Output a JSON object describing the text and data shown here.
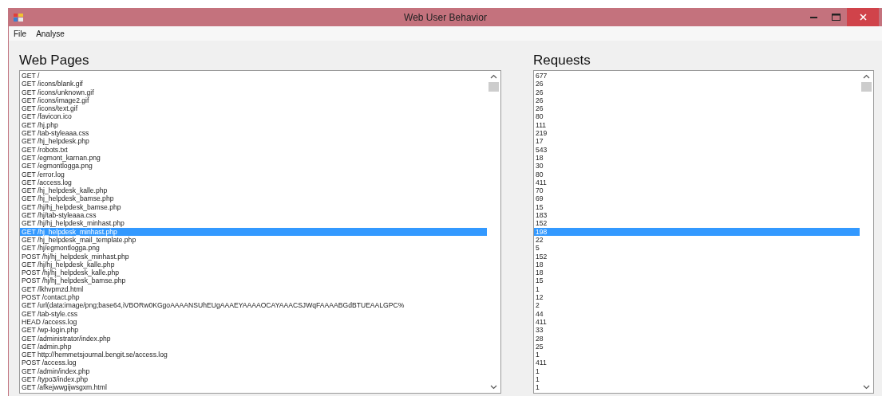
{
  "window": {
    "title": "Web User Behavior"
  },
  "menu": [
    "File",
    "Analyse"
  ],
  "pages": {
    "heading": "Web Pages",
    "items": [
      {
        "text": "GET /",
        "selected": false
      },
      {
        "text": "GET /icons/blank.gif",
        "selected": false
      },
      {
        "text": "GET /icons/unknown.gif",
        "selected": false
      },
      {
        "text": "GET /icons/image2.gif",
        "selected": false
      },
      {
        "text": "GET /icons/text.gif",
        "selected": false
      },
      {
        "text": "GET /favicon.ico",
        "selected": false
      },
      {
        "text": "GET /hj.php",
        "selected": false
      },
      {
        "text": "GET /tab-styleaaa.css",
        "selected": false
      },
      {
        "text": "GET /hj_helpdesk.php",
        "selected": false
      },
      {
        "text": "GET /robots.txt",
        "selected": false
      },
      {
        "text": "GET /egmont_karnan.png",
        "selected": false
      },
      {
        "text": "GET /egmontlogga.png",
        "selected": false
      },
      {
        "text": "GET /error.log",
        "selected": false
      },
      {
        "text": "GET /access.log",
        "selected": false
      },
      {
        "text": "GET /hj_helpdesk_kalle.php",
        "selected": false
      },
      {
        "text": "GET /hj_helpdesk_bamse.php",
        "selected": false
      },
      {
        "text": "GET /hj/hj_helpdesk_bamse.php",
        "selected": false
      },
      {
        "text": "GET /hj/tab-styleaaa.css",
        "selected": false
      },
      {
        "text": "GET /hj/hj_helpdesk_minhast.php",
        "selected": false
      },
      {
        "text": "GET /hj_helpdesk_minhast.php",
        "selected": true
      },
      {
        "text": "GET /hj_helpdesk_mail_template.php",
        "selected": false
      },
      {
        "text": "GET /hj/egmontlogga.png",
        "selected": false
      },
      {
        "text": "POST /hj/hj_helpdesk_minhast.php",
        "selected": false
      },
      {
        "text": "GET /hj/hj_helpdesk_kalle.php",
        "selected": false
      },
      {
        "text": "POST /hj/hj_helpdesk_kalle.php",
        "selected": false
      },
      {
        "text": "POST /hj/hj_helpdesk_bamse.php",
        "selected": false
      },
      {
        "text": "GET /lkhvpmzd.html",
        "selected": false
      },
      {
        "text": "POST /contact.php",
        "selected": false
      },
      {
        "text": "GET /url(data:image/png;base64,iVBORw0KGgoAAAANSUhEUgAAAEYAAAAOCAYAAACSJWqFAAAABGdBTUEAALGPC%",
        "selected": false
      },
      {
        "text": "GET /tab-style.css",
        "selected": false
      },
      {
        "text": "HEAD /access.log",
        "selected": false
      },
      {
        "text": "GET /wp-login.php",
        "selected": false
      },
      {
        "text": "GET /administrator/index.php",
        "selected": false
      },
      {
        "text": "GET /admin.php",
        "selected": false
      },
      {
        "text": "GET http://hemmetsjournal.bengit.se/access.log",
        "selected": false
      },
      {
        "text": "POST /access.log",
        "selected": false
      },
      {
        "text": "GET /admin/index.php",
        "selected": false
      },
      {
        "text": "GET /typo3/index.php",
        "selected": false
      },
      {
        "text": "GET /afkejwwgijwsgxm.html",
        "selected": false
      }
    ]
  },
  "requests": {
    "heading": "Requests",
    "items": [
      {
        "text": "677",
        "selected": false
      },
      {
        "text": "26",
        "selected": false
      },
      {
        "text": "26",
        "selected": false
      },
      {
        "text": "26",
        "selected": false
      },
      {
        "text": "26",
        "selected": false
      },
      {
        "text": "80",
        "selected": false
      },
      {
        "text": "111",
        "selected": false
      },
      {
        "text": "219",
        "selected": false
      },
      {
        "text": "17",
        "selected": false
      },
      {
        "text": "543",
        "selected": false
      },
      {
        "text": "18",
        "selected": false
      },
      {
        "text": "30",
        "selected": false
      },
      {
        "text": "80",
        "selected": false
      },
      {
        "text": "411",
        "selected": false
      },
      {
        "text": "70",
        "selected": false
      },
      {
        "text": "69",
        "selected": false
      },
      {
        "text": "15",
        "selected": false
      },
      {
        "text": "183",
        "selected": false
      },
      {
        "text": "152",
        "selected": false
      },
      {
        "text": "198",
        "selected": true
      },
      {
        "text": "22",
        "selected": false
      },
      {
        "text": "5",
        "selected": false
      },
      {
        "text": "152",
        "selected": false
      },
      {
        "text": "18",
        "selected": false
      },
      {
        "text": "18",
        "selected": false
      },
      {
        "text": "15",
        "selected": false
      },
      {
        "text": "1",
        "selected": false
      },
      {
        "text": "12",
        "selected": false
      },
      {
        "text": "2",
        "selected": false
      },
      {
        "text": "44",
        "selected": false
      },
      {
        "text": "411",
        "selected": false
      },
      {
        "text": "33",
        "selected": false
      },
      {
        "text": "28",
        "selected": false
      },
      {
        "text": "25",
        "selected": false
      },
      {
        "text": "1",
        "selected": false
      },
      {
        "text": "411",
        "selected": false
      },
      {
        "text": "1",
        "selected": false
      },
      {
        "text": "1",
        "selected": false
      },
      {
        "text": "1",
        "selected": false
      }
    ]
  }
}
